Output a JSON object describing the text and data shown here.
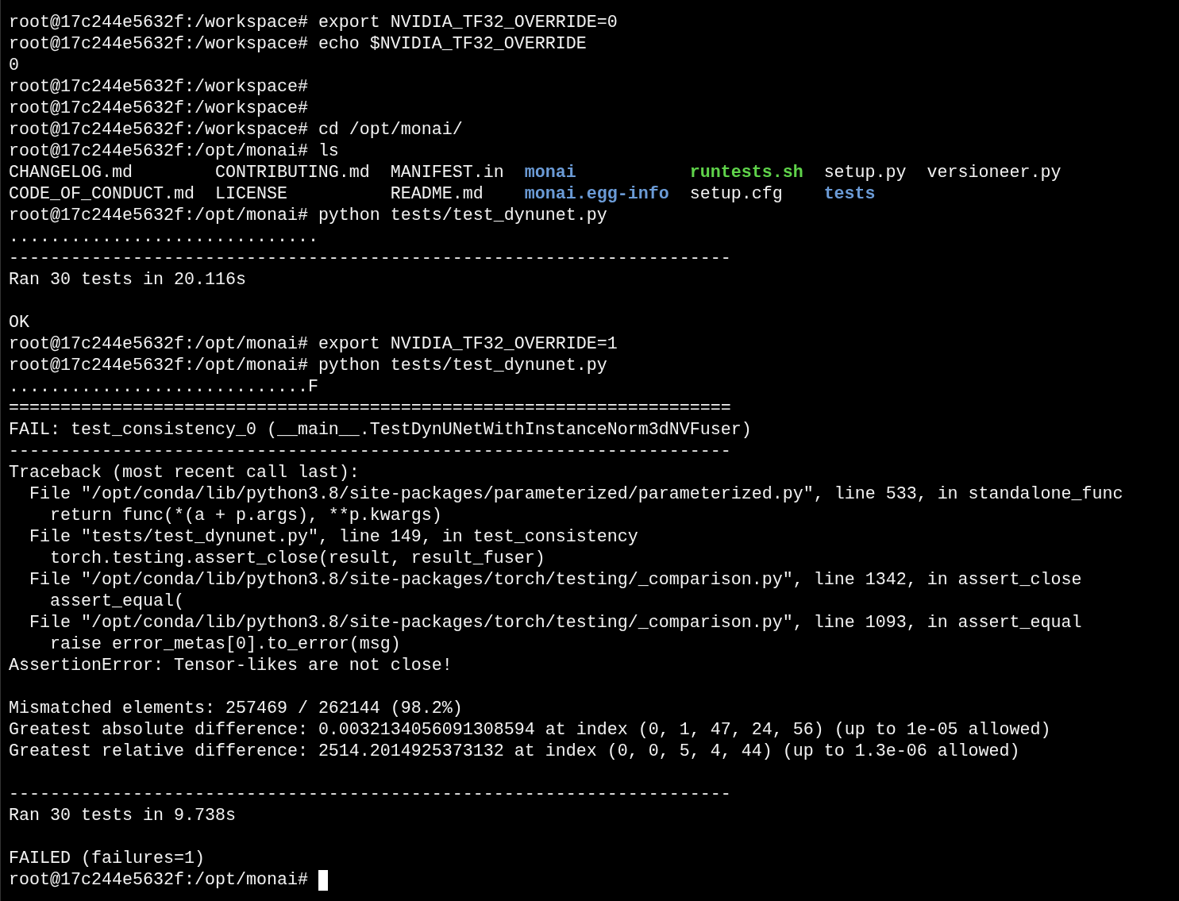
{
  "terminal": {
    "lines": [
      {
        "kind": "text",
        "text": "root@17c244e5632f:/workspace# export NVIDIA_TF32_OVERRIDE=0"
      },
      {
        "kind": "text",
        "text": "root@17c244e5632f:/workspace# echo $NVIDIA_TF32_OVERRIDE"
      },
      {
        "kind": "text",
        "text": "0"
      },
      {
        "kind": "text",
        "text": "root@17c244e5632f:/workspace#"
      },
      {
        "kind": "text",
        "text": "root@17c244e5632f:/workspace#"
      },
      {
        "kind": "text",
        "text": "root@17c244e5632f:/workspace# cd /opt/monai/"
      },
      {
        "kind": "text",
        "text": "root@17c244e5632f:/opt/monai# ls"
      },
      {
        "kind": "listing",
        "entries": [
          {
            "text": "CHANGELOG.md",
            "kind": "file"
          },
          {
            "text": "CONTRIBUTING.md",
            "kind": "file"
          },
          {
            "text": "MANIFEST.in",
            "kind": "file"
          },
          {
            "text": "monai",
            "kind": "dir"
          },
          {
            "text": "runtests.sh",
            "kind": "exec"
          },
          {
            "text": "setup.py",
            "kind": "file"
          },
          {
            "text": "versioneer.py",
            "kind": "file"
          },
          {
            "text": "CODE_OF_CONDUCT.md",
            "kind": "file"
          },
          {
            "text": "LICENSE",
            "kind": "file"
          },
          {
            "text": "README.md",
            "kind": "file"
          },
          {
            "text": "monai.egg-info",
            "kind": "dir"
          },
          {
            "text": "setup.cfg",
            "kind": "file"
          },
          {
            "text": "tests",
            "kind": "dir"
          }
        ]
      },
      {
        "kind": "text",
        "text": "root@17c244e5632f:/opt/monai# python tests/test_dynunet.py"
      },
      {
        "kind": "text",
        "text": ".............................."
      },
      {
        "kind": "text",
        "text": "----------------------------------------------------------------------"
      },
      {
        "kind": "text",
        "text": "Ran 30 tests in 20.116s"
      },
      {
        "kind": "blank"
      },
      {
        "kind": "text",
        "text": "OK"
      },
      {
        "kind": "text",
        "text": "root@17c244e5632f:/opt/monai# export NVIDIA_TF32_OVERRIDE=1"
      },
      {
        "kind": "text",
        "text": "root@17c244e5632f:/opt/monai# python tests/test_dynunet.py"
      },
      {
        "kind": "text",
        "text": ".............................F"
      },
      {
        "kind": "text",
        "text": "======================================================================"
      },
      {
        "kind": "text",
        "text": "FAIL: test_consistency_0 (__main__.TestDynUNetWithInstanceNorm3dNVFuser)"
      },
      {
        "kind": "text",
        "text": "----------------------------------------------------------------------"
      },
      {
        "kind": "text",
        "text": "Traceback (most recent call last):"
      },
      {
        "kind": "text",
        "text": "  File \"/opt/conda/lib/python3.8/site-packages/parameterized/parameterized.py\", line 533, in standalone_func"
      },
      {
        "kind": "text",
        "text": "    return func(*(a + p.args), **p.kwargs)"
      },
      {
        "kind": "text",
        "text": "  File \"tests/test_dynunet.py\", line 149, in test_consistency"
      },
      {
        "kind": "text",
        "text": "    torch.testing.assert_close(result, result_fuser)"
      },
      {
        "kind": "text",
        "text": "  File \"/opt/conda/lib/python3.8/site-packages/torch/testing/_comparison.py\", line 1342, in assert_close"
      },
      {
        "kind": "text",
        "text": "    assert_equal("
      },
      {
        "kind": "text",
        "text": "  File \"/opt/conda/lib/python3.8/site-packages/torch/testing/_comparison.py\", line 1093, in assert_equal"
      },
      {
        "kind": "text",
        "text": "    raise error_metas[0].to_error(msg)"
      },
      {
        "kind": "text",
        "text": "AssertionError: Tensor-likes are not close!"
      },
      {
        "kind": "blank"
      },
      {
        "kind": "text",
        "text": "Mismatched elements: 257469 / 262144 (98.2%)"
      },
      {
        "kind": "text",
        "text": "Greatest absolute difference: 0.0032134056091308594 at index (0, 1, 47, 24, 56) (up to 1e-05 allowed)"
      },
      {
        "kind": "text",
        "text": "Greatest relative difference: 2514.2014925373132 at index (0, 0, 5, 4, 44) (up to 1.3e-06 allowed)"
      },
      {
        "kind": "blank"
      },
      {
        "kind": "text",
        "text": "----------------------------------------------------------------------"
      },
      {
        "kind": "text",
        "text": "Ran 30 tests in 9.738s"
      },
      {
        "kind": "blank"
      },
      {
        "kind": "text",
        "text": "FAILED (failures=1)"
      },
      {
        "kind": "prompt",
        "text": "root@17c244e5632f:/opt/monai#",
        "cursor": true
      }
    ]
  }
}
